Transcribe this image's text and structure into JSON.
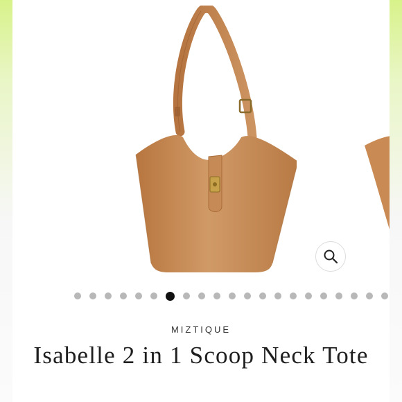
{
  "product": {
    "brand": "MIZTIQUE",
    "title": "Isabelle 2 in 1 Scoop Neck Tote"
  },
  "gallery": {
    "total_images": 21,
    "active_index": 6,
    "zoom_icon": "magnifier-icon",
    "image_color": "#c98a54"
  },
  "colors": {
    "edge_accent": "#d8f28a",
    "dot_inactive": "#b8b8b8",
    "dot_active": "#111111"
  }
}
